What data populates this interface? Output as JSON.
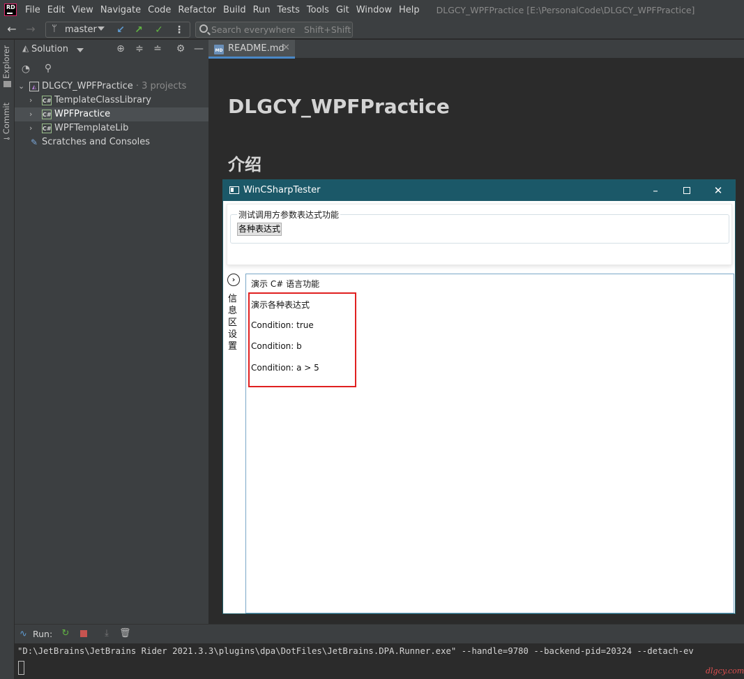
{
  "app": {
    "logo": "RD",
    "window_title": "DLGCY_WPFPractice [E:\\PersonalCode\\DLGCY_WPFPractice]"
  },
  "menu": [
    "File",
    "Edit",
    "View",
    "Navigate",
    "Code",
    "Refactor",
    "Build",
    "Run",
    "Tests",
    "Tools",
    "Git",
    "Window",
    "Help"
  ],
  "toolbar": {
    "back_icon": "arrow-left-icon",
    "forward_icon": "arrow-right-icon",
    "branch": "master",
    "vcs_update_icon": "arrow-down-left-icon",
    "vcs_push_icon": "arrow-up-right-icon",
    "vcs_commit_icon": "check-icon",
    "search_placeholder": "Search everywhere",
    "search_shortcut": "Shift+Shift"
  },
  "side_tabs": {
    "explorer": "Explorer",
    "commit": "Commit"
  },
  "explorer": {
    "header": "Solution",
    "tree": [
      {
        "label": "DLGCY_WPFPractice",
        "meta": " · 3 projects",
        "expanded": true
      },
      {
        "label": "TemplateClassLibrary",
        "icon_text": "C#"
      },
      {
        "label": "WPFPractice",
        "icon_text": "C#",
        "selected": true
      },
      {
        "label": "WPFTemplateLib",
        "icon_text": "C#"
      },
      {
        "label": "Scratches and Consoles"
      }
    ]
  },
  "editor": {
    "tab_label": "README.md",
    "md_icon": "MD",
    "h1": "DLGCY_WPFPractice",
    "h2": "介绍"
  },
  "wpf_window": {
    "title": "WinCSharpTester",
    "groupbox_title": "测试调用方参数表达式功能",
    "button_label": "各种表达式",
    "expander_label": "信息区设置",
    "info_lines": [
      "演示 C# 语言功能",
      "演示各种表达式",
      "Condition: true",
      "Condition: b",
      "Condition: a > 5"
    ]
  },
  "run_panel": {
    "label": "Run:",
    "console_text": "\"D:\\JetBrains\\JetBrains Rider 2021.3.3\\plugins\\dpa\\DotFiles\\JetBrains.DPA.Runner.exe\" --handle=9780 --backend-pid=20324 --detach-ev"
  },
  "watermark": "dlgcy.com",
  "colors": {
    "ide_bg": "#2b2b2b",
    "panel_bg": "#3c3f41",
    "wpf_titlebar": "#1b5868",
    "highlight": "#e02020",
    "tab_underline": "#4a88c7"
  }
}
